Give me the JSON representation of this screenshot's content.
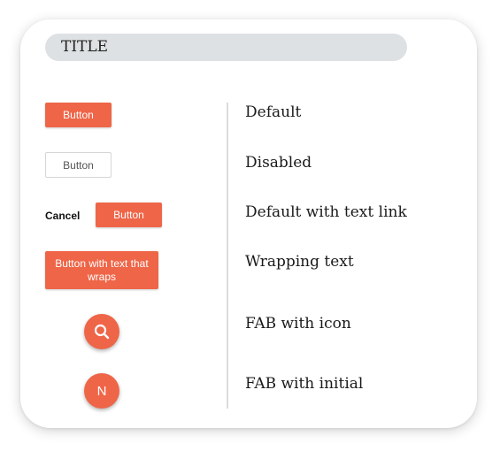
{
  "header": {
    "title": "TITLE"
  },
  "examples": {
    "default": {
      "button_label": "Button",
      "description": "Default"
    },
    "disabled": {
      "button_label": "Button",
      "description": "Disabled"
    },
    "with_link": {
      "link_label": "Cancel",
      "button_label": "Button",
      "description": "Default with text link"
    },
    "wrapping": {
      "button_label": "Button with text that wraps",
      "description": "Wrapping text"
    },
    "fab_icon": {
      "icon": "search-icon",
      "description": "FAB with icon"
    },
    "fab_initial": {
      "initial": "N",
      "description": "FAB with initial"
    }
  },
  "colors": {
    "accent": "#ef6548",
    "title_background": "#dde1e3",
    "divider": "#dcdcdc"
  }
}
